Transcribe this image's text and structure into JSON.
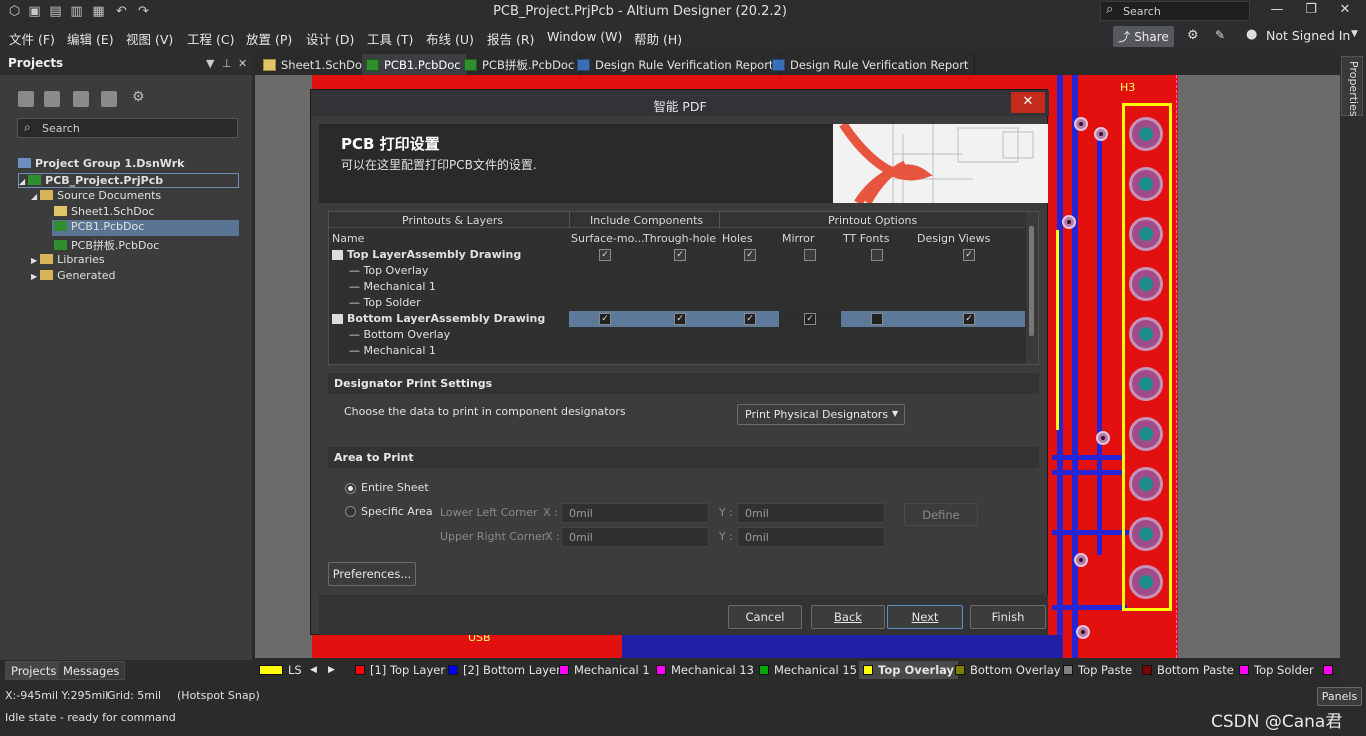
{
  "window": {
    "title": "PCB_Project.PrjPcb - Altium Designer (20.2.2)",
    "search_placeholder": "Search"
  },
  "menu": [
    "文件 (F)",
    "编辑 (E)",
    "视图 (V)",
    "工程 (C)",
    "放置 (P)",
    "设计 (D)",
    "工具 (T)",
    "布线 (U)",
    "报告 (R)",
    "Window (W)",
    "帮助 (H)"
  ],
  "header_right": {
    "share": "Share",
    "user": "Not Signed In"
  },
  "tabs": [
    "Sheet1.SchDoc",
    "PCB1.PcbDoc",
    "PCB拼板.PcbDoc",
    "Design Rule Verification Report",
    "Design Rule Verification Report"
  ],
  "projects": {
    "title": "Projects",
    "search": "Search",
    "tree": [
      "Project Group 1.DsnWrk",
      "PCB_Project.PrjPcb",
      "Source Documents",
      "Sheet1.SchDoc",
      "PCB1.PcbDoc",
      "PCB拼板.PcbDoc",
      "Libraries",
      "Generated"
    ],
    "bottom_tabs": [
      "Projects",
      "Messages"
    ]
  },
  "dialog": {
    "title": "智能 PDF",
    "heading": "PCB 打印设置",
    "subheading": "可以在这里配置打印PCB文件的设置.",
    "group_headers": [
      "Printouts & Layers",
      "Include Components",
      "Printout Options"
    ],
    "columns": [
      "Name",
      "Surface-mo...",
      "Through-hole",
      "Holes",
      "Mirror",
      "TT Fonts",
      "Design Views"
    ],
    "rows": [
      {
        "name": "Top LayerAssembly Drawing",
        "level": 0,
        "checks": [
          true,
          true,
          true,
          false,
          false,
          true
        ]
      },
      {
        "name": "Top Overlay",
        "level": 1
      },
      {
        "name": "Mechanical 1",
        "level": 1
      },
      {
        "name": "Top Solder",
        "level": 1
      },
      {
        "name": "Bottom LayerAssembly Drawing",
        "level": 0,
        "checks": [
          true,
          true,
          true,
          true,
          false,
          true
        ],
        "selected": true
      },
      {
        "name": "Bottom Overlay",
        "level": 1
      },
      {
        "name": "Mechanical 1",
        "level": 1
      }
    ],
    "designator_section": "Designator Print Settings",
    "designator_label": "Choose the data to print in component designators",
    "designator_value": "Print Physical Designators",
    "area_section": "Area to Print",
    "radio_entire": "Entire Sheet",
    "radio_specific": "Specific Area",
    "lower_left": "Lower Left Corner",
    "upper_right": "Upper Right Corner",
    "x_label": "X :",
    "y_label": "Y :",
    "ll_x": "0mil",
    "ll_y": "0mil",
    "ur_x": "0mil",
    "ur_y": "0mil",
    "define": "Define",
    "preferences": "Preferences...",
    "cancel": "Cancel",
    "back": "Back",
    "next": "Next",
    "finish": "Finish"
  },
  "pcb": {
    "label_h3": "H3",
    "label_usb": "USB"
  },
  "layers": [
    {
      "label": "LS",
      "color": "#ffff00"
    },
    {
      "label": "[1] Top Layer",
      "color": "#ff0000"
    },
    {
      "label": "[2] Bottom Layer",
      "color": "#0000ff"
    },
    {
      "label": "Mechanical 1",
      "color": "#ff00ff"
    },
    {
      "label": "Mechanical 13",
      "color": "#ff00ff"
    },
    {
      "label": "Mechanical 15",
      "color": "#00aa00"
    },
    {
      "label": "Top Overlay",
      "color": "#ffff00"
    },
    {
      "label": "Bottom Overlay",
      "color": "#808000"
    },
    {
      "label": "Top Paste",
      "color": "#808080"
    },
    {
      "label": "Bottom Paste",
      "color": "#800000"
    },
    {
      "label": "Top Solder",
      "color": "#ff00ff"
    }
  ],
  "status": {
    "coords": "X:-945mil Y:295mil",
    "grid": "Grid: 5mil",
    "snap": "(Hotspot Snap)",
    "state": "Idle state - ready for command",
    "panels": "Panels",
    "properties": "Properties",
    "watermark": "CSDN @Cana君"
  }
}
